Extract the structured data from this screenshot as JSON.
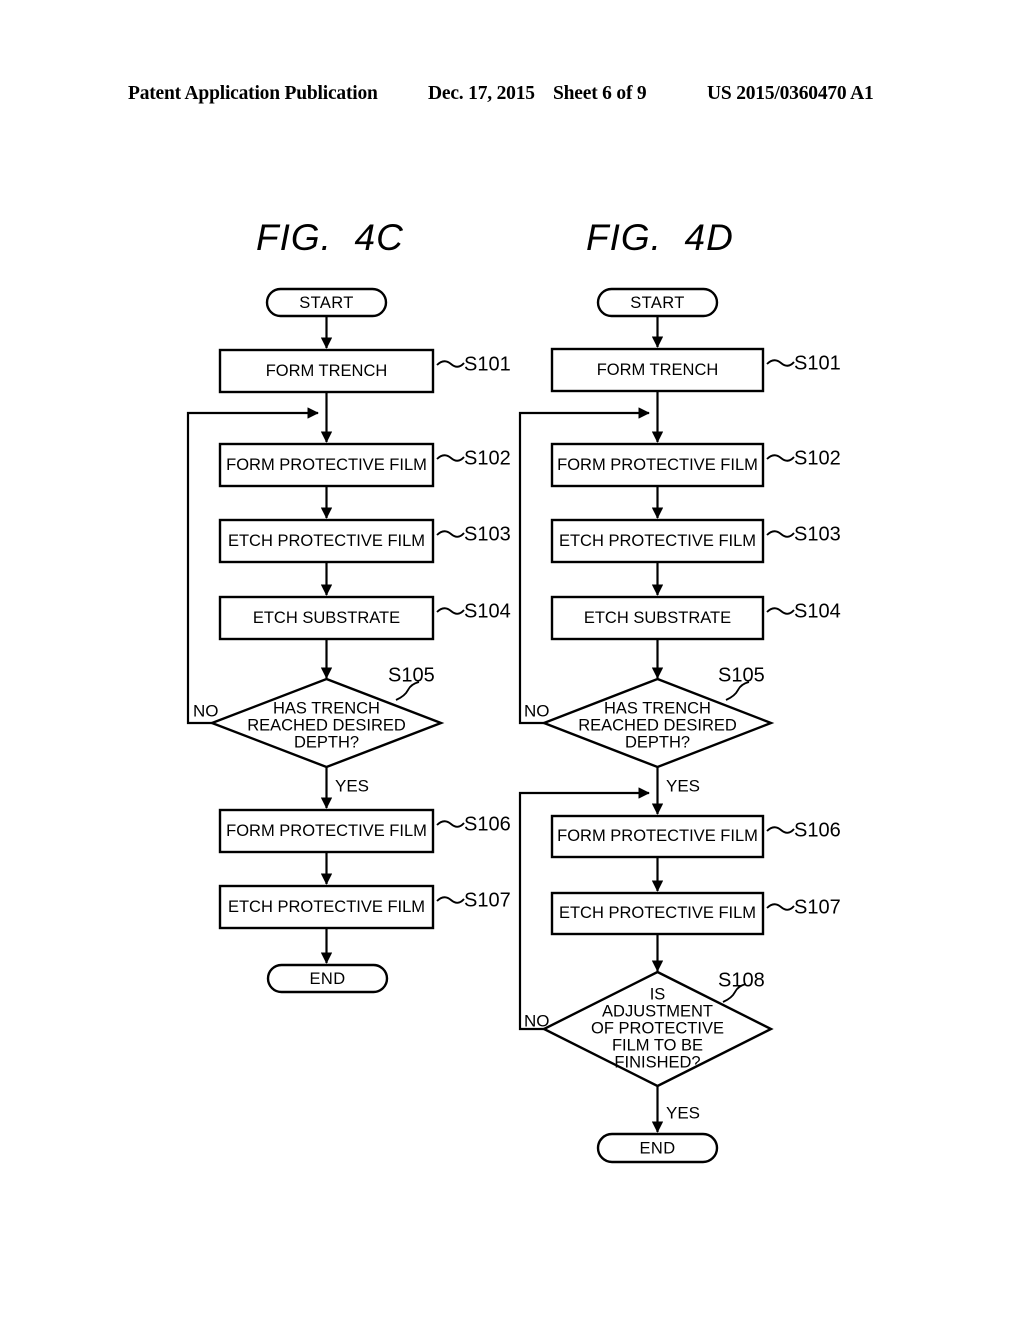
{
  "header": {
    "publication": "Patent Application Publication",
    "date": "Dec. 17, 2015",
    "sheet": "Sheet 6 of 9",
    "patent_number": "US 2015/0360470 A1"
  },
  "figures": [
    {
      "id": "fig-4c",
      "title": "FIG.  4C",
      "start_label": "START",
      "end_label": "END",
      "steps": [
        {
          "id": "s101",
          "text": "FORM TRENCH",
          "label": "S101"
        },
        {
          "id": "s102",
          "text": "FORM PROTECTIVE FILM",
          "label": "S102"
        },
        {
          "id": "s103",
          "text": "ETCH PROTECTIVE FILM",
          "label": "S103"
        },
        {
          "id": "s104",
          "text": "ETCH SUBSTRATE",
          "label": "S104"
        },
        {
          "id": "s106",
          "text": "FORM PROTECTIVE FILM",
          "label": "S106"
        },
        {
          "id": "s107",
          "text": "ETCH PROTECTIVE FILM",
          "label": "S107"
        }
      ],
      "decisions": [
        {
          "id": "s105",
          "label": "S105",
          "lines": [
            "HAS TRENCH",
            "REACHED DESIRED",
            "DEPTH?"
          ],
          "no_label": "NO",
          "yes_label": "YES"
        }
      ]
    },
    {
      "id": "fig-4d",
      "title": "FIG.  4D",
      "start_label": "START",
      "end_label": "END",
      "steps": [
        {
          "id": "s101",
          "text": "FORM TRENCH",
          "label": "S101"
        },
        {
          "id": "s102",
          "text": "FORM PROTECTIVE FILM",
          "label": "S102"
        },
        {
          "id": "s103",
          "text": "ETCH PROTECTIVE FILM",
          "label": "S103"
        },
        {
          "id": "s104",
          "text": "ETCH SUBSTRATE",
          "label": "S104"
        },
        {
          "id": "s106",
          "text": "FORM PROTECTIVE FILM",
          "label": "S106"
        },
        {
          "id": "s107",
          "text": "ETCH PROTECTIVE FILM",
          "label": "S107"
        }
      ],
      "decisions": [
        {
          "id": "s105",
          "label": "S105",
          "lines": [
            "HAS TRENCH",
            "REACHED DESIRED",
            "DEPTH?"
          ],
          "no_label": "NO",
          "yes_label": "YES"
        },
        {
          "id": "s108",
          "label": "S108",
          "lines": [
            "IS",
            "ADJUSTMENT",
            "OF PROTECTIVE",
            "FILM TO BE",
            "FINISHED?"
          ],
          "no_label": "NO",
          "yes_label": "YES"
        }
      ]
    }
  ],
  "colors": {
    "ink": "#000000",
    "paper": "#ffffff"
  }
}
